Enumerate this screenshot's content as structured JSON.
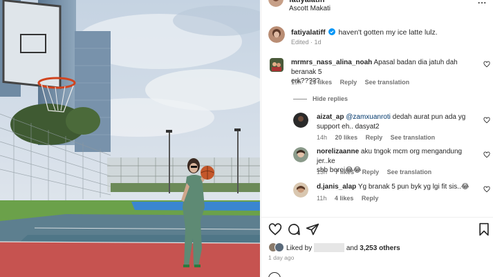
{
  "post_header": {
    "username": "fatiyalatiff",
    "location": "Ascott Makati",
    "more_label": "..."
  },
  "caption": {
    "username": "fatiyalatiff",
    "text": "haven't gotten my ice latte lulz.",
    "edited": "Edited",
    "age": "1d"
  },
  "comments": [
    {
      "username": "mrmrs_nass_alina_noah",
      "text_line1": "Apasal badan dia jatuh dah beranak 5",
      "text_line2": "erk?????",
      "time": "19h",
      "likes": "29 likes",
      "reply": "Reply",
      "translate": "See translation"
    }
  ],
  "hide_replies_label": "Hide replies",
  "replies": [
    {
      "username": "aizat_ap",
      "mention": "@zamxuanroti",
      "text_line1_rest": " dedah aurat pun ada yg",
      "text_line2": "support eh.. dasyat2",
      "time": "14h",
      "likes": "20 likes",
      "reply": "Reply",
      "translate": "See translation"
    },
    {
      "username": "norelizaanne",
      "text_line1": "aku tngok mcm org mengandung jer..ke",
      "text_line2": "sbb boroi😂😂",
      "time": "13h",
      "likes": "7 likes",
      "reply": "Reply",
      "translate": "See translation"
    },
    {
      "username": "d.janis_alap",
      "text_line1": "Yg branak 5 pun byk yg lgi fit sis..😂",
      "time": "11h",
      "likes": "4 likes",
      "reply": "Reply"
    }
  ],
  "likes_summary": {
    "prefix": "Liked by",
    "joiner": "and",
    "others": "3,253 others"
  },
  "post_date": "1 day ago",
  "colors": {
    "link_blue": "#00376b",
    "muted_gray": "#737373",
    "verified_blue": "#0095f6",
    "sky": "#cfdae6",
    "court_blue": "#3d7fc7",
    "court_red": "#c8534e"
  },
  "icons": [
    "more-icon",
    "verified-icon",
    "heart-icon",
    "comment-icon",
    "share-icon",
    "bookmark-icon"
  ]
}
